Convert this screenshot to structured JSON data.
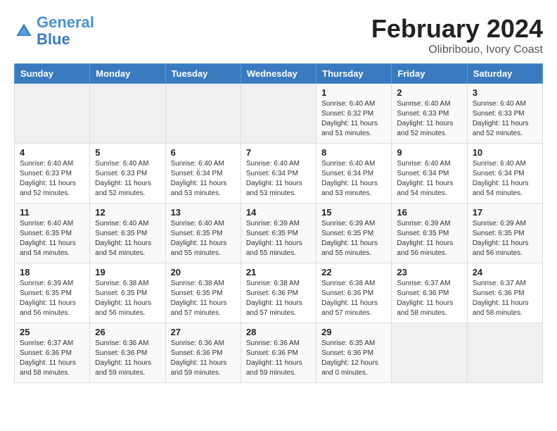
{
  "header": {
    "logo_general": "General",
    "logo_blue": "Blue",
    "month_year": "February 2024",
    "location": "Olibribouo, Ivory Coast"
  },
  "days_of_week": [
    "Sunday",
    "Monday",
    "Tuesday",
    "Wednesday",
    "Thursday",
    "Friday",
    "Saturday"
  ],
  "weeks": [
    [
      {
        "day": "",
        "info": ""
      },
      {
        "day": "",
        "info": ""
      },
      {
        "day": "",
        "info": ""
      },
      {
        "day": "",
        "info": ""
      },
      {
        "day": "1",
        "info": "Sunrise: 6:40 AM\nSunset: 6:32 PM\nDaylight: 11 hours\nand 51 minutes."
      },
      {
        "day": "2",
        "info": "Sunrise: 6:40 AM\nSunset: 6:33 PM\nDaylight: 11 hours\nand 52 minutes."
      },
      {
        "day": "3",
        "info": "Sunrise: 6:40 AM\nSunset: 6:33 PM\nDaylight: 11 hours\nand 52 minutes."
      }
    ],
    [
      {
        "day": "4",
        "info": "Sunrise: 6:40 AM\nSunset: 6:33 PM\nDaylight: 11 hours\nand 52 minutes."
      },
      {
        "day": "5",
        "info": "Sunrise: 6:40 AM\nSunset: 6:33 PM\nDaylight: 11 hours\nand 52 minutes."
      },
      {
        "day": "6",
        "info": "Sunrise: 6:40 AM\nSunset: 6:34 PM\nDaylight: 11 hours\nand 53 minutes."
      },
      {
        "day": "7",
        "info": "Sunrise: 6:40 AM\nSunset: 6:34 PM\nDaylight: 11 hours\nand 53 minutes."
      },
      {
        "day": "8",
        "info": "Sunrise: 6:40 AM\nSunset: 6:34 PM\nDaylight: 11 hours\nand 53 minutes."
      },
      {
        "day": "9",
        "info": "Sunrise: 6:40 AM\nSunset: 6:34 PM\nDaylight: 11 hours\nand 54 minutes."
      },
      {
        "day": "10",
        "info": "Sunrise: 6:40 AM\nSunset: 6:34 PM\nDaylight: 11 hours\nand 54 minutes."
      }
    ],
    [
      {
        "day": "11",
        "info": "Sunrise: 6:40 AM\nSunset: 6:35 PM\nDaylight: 11 hours\nand 54 minutes."
      },
      {
        "day": "12",
        "info": "Sunrise: 6:40 AM\nSunset: 6:35 PM\nDaylight: 11 hours\nand 54 minutes."
      },
      {
        "day": "13",
        "info": "Sunrise: 6:40 AM\nSunset: 6:35 PM\nDaylight: 11 hours\nand 55 minutes."
      },
      {
        "day": "14",
        "info": "Sunrise: 6:39 AM\nSunset: 6:35 PM\nDaylight: 11 hours\nand 55 minutes."
      },
      {
        "day": "15",
        "info": "Sunrise: 6:39 AM\nSunset: 6:35 PM\nDaylight: 11 hours\nand 55 minutes."
      },
      {
        "day": "16",
        "info": "Sunrise: 6:39 AM\nSunset: 6:35 PM\nDaylight: 11 hours\nand 56 minutes."
      },
      {
        "day": "17",
        "info": "Sunrise: 6:39 AM\nSunset: 6:35 PM\nDaylight: 11 hours\nand 56 minutes."
      }
    ],
    [
      {
        "day": "18",
        "info": "Sunrise: 6:39 AM\nSunset: 6:35 PM\nDaylight: 11 hours\nand 56 minutes."
      },
      {
        "day": "19",
        "info": "Sunrise: 6:38 AM\nSunset: 6:35 PM\nDaylight: 11 hours\nand 56 minutes."
      },
      {
        "day": "20",
        "info": "Sunrise: 6:38 AM\nSunset: 6:35 PM\nDaylight: 11 hours\nand 57 minutes."
      },
      {
        "day": "21",
        "info": "Sunrise: 6:38 AM\nSunset: 6:36 PM\nDaylight: 11 hours\nand 57 minutes."
      },
      {
        "day": "22",
        "info": "Sunrise: 6:38 AM\nSunset: 6:36 PM\nDaylight: 11 hours\nand 57 minutes."
      },
      {
        "day": "23",
        "info": "Sunrise: 6:37 AM\nSunset: 6:36 PM\nDaylight: 11 hours\nand 58 minutes."
      },
      {
        "day": "24",
        "info": "Sunrise: 6:37 AM\nSunset: 6:36 PM\nDaylight: 11 hours\nand 58 minutes."
      }
    ],
    [
      {
        "day": "25",
        "info": "Sunrise: 6:37 AM\nSunset: 6:36 PM\nDaylight: 11 hours\nand 58 minutes."
      },
      {
        "day": "26",
        "info": "Sunrise: 6:36 AM\nSunset: 6:36 PM\nDaylight: 11 hours\nand 59 minutes."
      },
      {
        "day": "27",
        "info": "Sunrise: 6:36 AM\nSunset: 6:36 PM\nDaylight: 11 hours\nand 59 minutes."
      },
      {
        "day": "28",
        "info": "Sunrise: 6:36 AM\nSunset: 6:36 PM\nDaylight: 11 hours\nand 59 minutes."
      },
      {
        "day": "29",
        "info": "Sunrise: 6:35 AM\nSunset: 6:36 PM\nDaylight: 12 hours\nand 0 minutes."
      },
      {
        "day": "",
        "info": ""
      },
      {
        "day": "",
        "info": ""
      }
    ]
  ]
}
